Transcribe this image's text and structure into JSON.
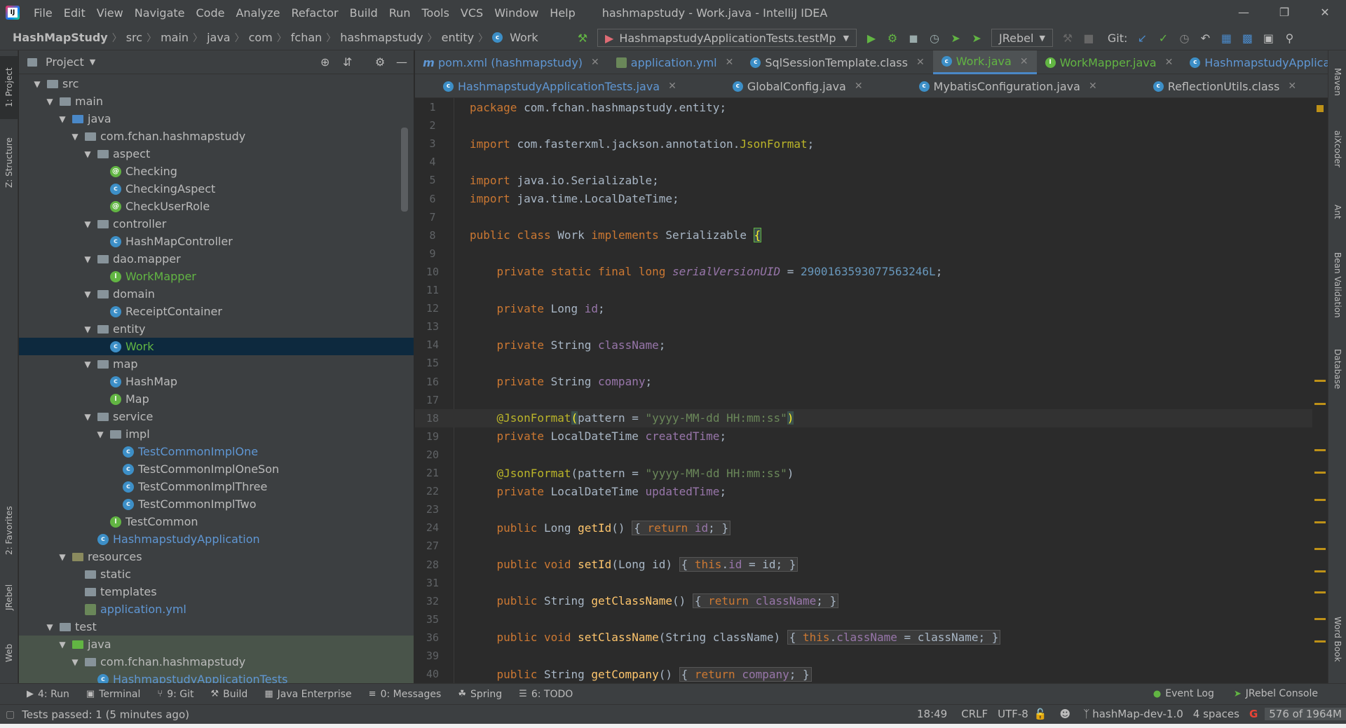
{
  "window": {
    "title": "hashmapstudy - Work.java - IntelliJ IDEA"
  },
  "menu": [
    "File",
    "Edit",
    "View",
    "Navigate",
    "Code",
    "Analyze",
    "Refactor",
    "Build",
    "Run",
    "Tools",
    "VCS",
    "Window",
    "Help"
  ],
  "breadcrumb": {
    "project": "HashMapStudy",
    "items": [
      "src",
      "main",
      "java",
      "com",
      "fchan",
      "hashmapstudy",
      "entity"
    ],
    "file": "Work"
  },
  "toolbar": {
    "run_config": "HashmapstudyApplicationTests.testMp",
    "jrebel": "JRebel",
    "git_label": "Git:"
  },
  "project_panel": {
    "title": "Project",
    "tree": [
      {
        "label": "src",
        "depth": 0,
        "kind": "folder",
        "expanded": true
      },
      {
        "label": "main",
        "depth": 1,
        "kind": "folder",
        "expanded": true
      },
      {
        "label": "java",
        "depth": 2,
        "kind": "src",
        "expanded": true
      },
      {
        "label": "com.fchan.hashmapstudy",
        "depth": 3,
        "kind": "folder",
        "expanded": true
      },
      {
        "label": "aspect",
        "depth": 4,
        "kind": "folder",
        "expanded": true
      },
      {
        "label": "Checking",
        "depth": 5,
        "kind": "annot"
      },
      {
        "label": "CheckingAspect",
        "depth": 5,
        "kind": "cls"
      },
      {
        "label": "CheckUserRole",
        "depth": 5,
        "kind": "annot"
      },
      {
        "label": "controller",
        "depth": 4,
        "kind": "folder",
        "expanded": true
      },
      {
        "label": "HashMapController",
        "depth": 5,
        "kind": "cls"
      },
      {
        "label": "dao.mapper",
        "depth": 4,
        "kind": "folder",
        "expanded": true
      },
      {
        "label": "WorkMapper",
        "depth": 5,
        "kind": "intf",
        "color": "green"
      },
      {
        "label": "domain",
        "depth": 4,
        "kind": "folder",
        "expanded": true
      },
      {
        "label": "ReceiptContainer",
        "depth": 5,
        "kind": "cls"
      },
      {
        "label": "entity",
        "depth": 4,
        "kind": "folder",
        "expanded": true
      },
      {
        "label": "Work",
        "depth": 5,
        "kind": "cls",
        "color": "green",
        "selected": true
      },
      {
        "label": "map",
        "depth": 4,
        "kind": "folder",
        "expanded": true
      },
      {
        "label": "HashMap",
        "depth": 5,
        "kind": "cls"
      },
      {
        "label": "Map",
        "depth": 5,
        "kind": "intf"
      },
      {
        "label": "service",
        "depth": 4,
        "kind": "folder",
        "expanded": true
      },
      {
        "label": "impl",
        "depth": 5,
        "kind": "folder",
        "expanded": true
      },
      {
        "label": "TestCommonImplOne",
        "depth": 6,
        "kind": "cls",
        "color": "blue"
      },
      {
        "label": "TestCommonImplOneSon",
        "depth": 6,
        "kind": "cls"
      },
      {
        "label": "TestCommonImplThree",
        "depth": 6,
        "kind": "cls"
      },
      {
        "label": "TestCommonImplTwo",
        "depth": 6,
        "kind": "cls"
      },
      {
        "label": "TestCommon",
        "depth": 5,
        "kind": "intf"
      },
      {
        "label": "HashmapstudyApplication",
        "depth": 4,
        "kind": "cls",
        "color": "blue"
      },
      {
        "label": "resources",
        "depth": 2,
        "kind": "res",
        "expanded": true
      },
      {
        "label": "static",
        "depth": 3,
        "kind": "folder"
      },
      {
        "label": "templates",
        "depth": 3,
        "kind": "folder"
      },
      {
        "label": "application.yml",
        "depth": 3,
        "kind": "yml",
        "color": "blue"
      },
      {
        "label": "test",
        "depth": 1,
        "kind": "folder",
        "expanded": true
      },
      {
        "label": "java",
        "depth": 2,
        "kind": "tst",
        "expanded": true,
        "testbg": true
      },
      {
        "label": "com.fchan.hashmapstudy",
        "depth": 3,
        "kind": "folder",
        "expanded": true,
        "testbg": true
      },
      {
        "label": "HashmapstudyApplicationTests",
        "depth": 4,
        "kind": "cls",
        "color": "blue",
        "testbg": true
      }
    ]
  },
  "editor_tabs_row1": [
    {
      "label": "pom.xml (hashmapstudy)",
      "icon": "m",
      "color": "blue"
    },
    {
      "label": "application.yml",
      "icon": "y",
      "color": "blue"
    },
    {
      "label": "SqlSessionTemplate.class",
      "icon": "c"
    },
    {
      "label": "Work.java",
      "icon": "c",
      "color": "green",
      "active": true
    },
    {
      "label": "WorkMapper.java",
      "icon": "i",
      "color": "green"
    },
    {
      "label": "HashmapstudyApplication.java",
      "icon": "c",
      "color": "blue"
    }
  ],
  "editor_tabs_row2": [
    {
      "label": "HashmapstudyApplicationTests.java",
      "icon": "c",
      "color": "blue"
    },
    {
      "label": "GlobalConfig.java",
      "icon": "c"
    },
    {
      "label": "MybatisConfiguration.java",
      "icon": "c"
    },
    {
      "label": "ReflectionUtils.class",
      "icon": "c"
    }
  ],
  "code": {
    "line_numbers": [
      "1",
      "2",
      "3",
      "4",
      "5",
      "6",
      "7",
      "8",
      "9",
      "10",
      "11",
      "12",
      "13",
      "14",
      "15",
      "16",
      "17",
      "18",
      "19",
      "20",
      "21",
      "22",
      "23",
      "24",
      "27",
      "28",
      "31",
      "32",
      "35",
      "36",
      "39",
      "40"
    ],
    "current_line": "18",
    "package": "com.fchan.hashmapstudy.entity",
    "import1": "com.fasterxml.jackson.annotation.",
    "import1_cls": "JsonFormat",
    "import2": "java.io.Serializable",
    "import3": "java.time.LocalDateTime",
    "class_name": "Work",
    "iface": "Serializable",
    "serial_field": "serialVersionUID",
    "serial_value": "2900163593077563246L",
    "field_id": "id",
    "field_class": "className",
    "field_company": "company",
    "annotation": "@JsonFormat",
    "pattern_key": "pattern",
    "pattern_value": "\"yyyy-MM-dd HH:mm:ss\"",
    "field_created": "createdTime",
    "field_updated": "updatedTime",
    "m_getId": "getId",
    "m_setId": "setId",
    "m_getClassName": "getClassName",
    "m_setClassName": "setClassName",
    "m_getCompany": "getCompany"
  },
  "bottom_tools": [
    "4: Run",
    "Terminal",
    "9: Git",
    "Build",
    "Java Enterprise",
    "0: Messages",
    "Spring",
    "6: TODO"
  ],
  "bottom_right_tools": [
    "Event Log",
    "JRebel Console"
  ],
  "left_strip": [
    "1: Project",
    "Z: Structure",
    "2: Favorites",
    "JRebel",
    "Web"
  ],
  "right_strip": [
    "Maven",
    "aiXcoder",
    "Ant",
    "Bean Validation",
    "Database",
    "Word Book"
  ],
  "status": {
    "message": "Tests passed: 1 (5 minutes ago)",
    "position": "18:49",
    "line_sep": "CRLF",
    "encoding": "UTF-8",
    "branch": "hashMap-dev-1.0",
    "indent": "4 spaces",
    "memory": "576 of 1964M"
  },
  "colors": {
    "accent": "#4a88c7",
    "green": "#62b543",
    "bg": "#2b2b2b",
    "panel": "#3c3f41"
  }
}
